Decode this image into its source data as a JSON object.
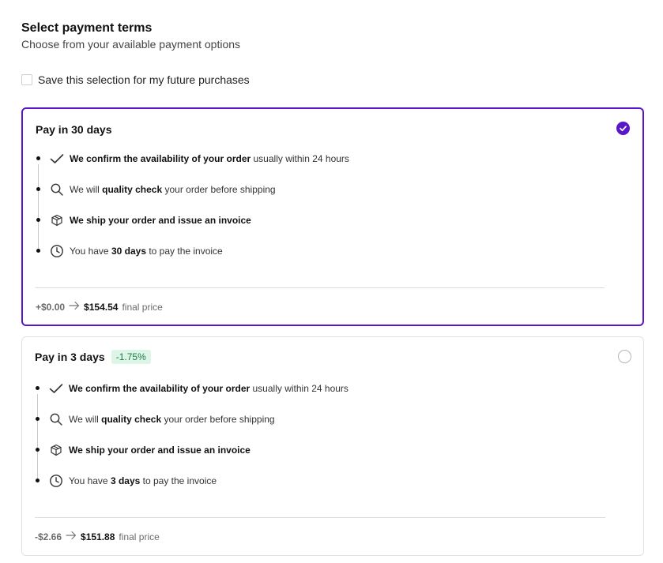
{
  "header": {
    "title": "Select payment terms",
    "subtitle": "Choose from your available payment options"
  },
  "save_selection": {
    "label": "Save this selection for my future purchases",
    "checked": false
  },
  "options": [
    {
      "title": "Pay in 30 days",
      "badge": "",
      "selected": true,
      "steps": [
        {
          "icon": "check-icon",
          "bold": "We confirm the availability of your order",
          "before": "",
          "after": " usually within 24 hours"
        },
        {
          "icon": "search-icon",
          "before": "We will ",
          "bold": "quality check",
          "after": " your order before shipping"
        },
        {
          "icon": "package-icon",
          "before": "",
          "bold": "We ship your order and issue an invoice",
          "after": ""
        },
        {
          "icon": "clock-icon",
          "before": "You have ",
          "bold": "30 days",
          "after": " to pay the invoice"
        }
      ],
      "price_delta": "+$0.00",
      "price_final": "$154.54",
      "price_suffix": "final price"
    },
    {
      "title": "Pay in 3 days",
      "badge": "-1.75%",
      "selected": false,
      "steps": [
        {
          "icon": "check-icon",
          "bold": "We confirm the availability of your order",
          "before": "",
          "after": " usually within 24 hours"
        },
        {
          "icon": "search-icon",
          "before": "We will ",
          "bold": "quality check",
          "after": " your order before shipping"
        },
        {
          "icon": "package-icon",
          "before": "",
          "bold": "We ship your order and issue an invoice",
          "after": ""
        },
        {
          "icon": "clock-icon",
          "before": "You have ",
          "bold": "3 days",
          "after": " to pay the invoice"
        }
      ],
      "price_delta": "-$2.66",
      "price_final": "$151.88",
      "price_suffix": "final price"
    }
  ],
  "colors": {
    "accent": "#5a17c9",
    "badge_bg": "#dcf5e6",
    "badge_text": "#1f7a47"
  }
}
